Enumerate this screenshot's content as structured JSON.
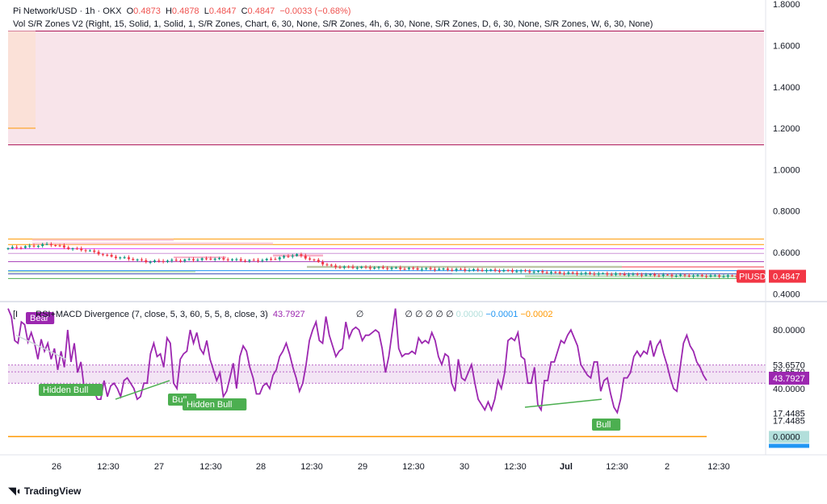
{
  "header": {
    "symbol": "Pi Network/USD · 1h · OKX",
    "open_label": "O",
    "open": "0.4873",
    "high_label": "H",
    "high": "0.4878",
    "low_label": "L",
    "low": "0.4847",
    "close_label": "C",
    "close": "0.4847",
    "change": "−0.0033 (−0.68%)",
    "indicator": "Vol S/R Zones V2 (Right, 15, Solid, 1, Solid, 1, S/R Zones, Chart, 6, 30, None, S/R Zones, 4h, 6, 30, None, S/R Zones, D, 6, 30, None, S/R Zones, W, 6, 30, None)"
  },
  "indicator_pane": {
    "prefix": "[I",
    "label": "RSI+MACD Divergence (7, close, 5, 3, 60, 5, 5, 8, close, 3)",
    "value": "43.7927",
    "empty": "∅",
    "empties": "∅ ∅ ∅ ∅ ∅",
    "v1": "0.0000",
    "v2": "−0.0001",
    "v3": "−0.0002"
  },
  "brand": {
    "name": "TradingView",
    "logo_icon": "tradingview-logo-icon"
  },
  "colors": {
    "price_tag": "#f23645",
    "rsi_line": "#9c27b0",
    "rsi_tag": "#9c27b0",
    "bull": "#4caf50",
    "bear": "#9c27b0",
    "macd_tag": "#b2dfdb",
    "macd_line": "#ff9800"
  },
  "chart_data": [
    {
      "type": "candlestick",
      "y_axis_ticks": [
        "1.8000",
        "1.6000",
        "1.4000",
        "1.2000",
        "1.0000",
        "0.8000",
        "0.6000",
        "0.4000"
      ],
      "ylim": [
        0.37,
        1.82
      ],
      "last_price_label": "PIUSD",
      "last_price": "0.4847",
      "close_path": [
        [
          0,
          0.62
        ],
        [
          5,
          0.63
        ],
        [
          9,
          0.64
        ],
        [
          13,
          0.62
        ],
        [
          17,
          0.61
        ],
        [
          22,
          0.58
        ],
        [
          26,
          0.57
        ],
        [
          30,
          0.555
        ],
        [
          35,
          0.56
        ],
        [
          40,
          0.565
        ],
        [
          44,
          0.57
        ],
        [
          48,
          0.565
        ],
        [
          52,
          0.56
        ],
        [
          56,
          0.565
        ],
        [
          60,
          0.58
        ],
        [
          62,
          0.59
        ],
        [
          66,
          0.56
        ],
        [
          70,
          0.53
        ],
        [
          80,
          0.525
        ],
        [
          90,
          0.52
        ],
        [
          100,
          0.515
        ],
        [
          110,
          0.51
        ],
        [
          120,
          0.5
        ],
        [
          130,
          0.495
        ],
        [
          140,
          0.49
        ],
        [
          150,
          0.487
        ],
        [
          157,
          0.485
        ]
      ],
      "x_tick_labels": [
        "26",
        "12:30",
        "27",
        "12:30",
        "28",
        "12:30",
        "29",
        "12:30",
        "30",
        "12:30",
        "Jul",
        "12:30",
        "2",
        "12:30"
      ],
      "zones": [
        {
          "from": 1.12,
          "to": 1.67,
          "color": "#f8e4ea"
        },
        {
          "from": 1.2,
          "to": 1.67,
          "color": "#fbe1d8"
        }
      ]
    },
    {
      "type": "line",
      "name": "RSI+MACD Divergence",
      "y_axis_ticks": [
        "80.0000",
        "53.6570",
        "53.6570",
        "40.0000",
        "17.4485",
        "17.4485",
        "0.0000"
      ],
      "levels": {
        "upper": 53.657,
        "mid": 48.5,
        "lower": 40.0
      },
      "last_value": "43.7927",
      "macd_value": "0.0000",
      "values": [
        96,
        90,
        72,
        70,
        86,
        84,
        71,
        78,
        70,
        58,
        73,
        64,
        70,
        58,
        66,
        50,
        64,
        52,
        80,
        56,
        70,
        48,
        56,
        36,
        35,
        34,
        34,
        28,
        28,
        42,
        30,
        38,
        40,
        36,
        30,
        42,
        44,
        40,
        36,
        28,
        30,
        40,
        40,
        62,
        70,
        60,
        62,
        52,
        74,
        70,
        40,
        36,
        58,
        62,
        64,
        80,
        70,
        78,
        66,
        62,
        72,
        58,
        50,
        42,
        48,
        30,
        34,
        44,
        55,
        36,
        60,
        68,
        64,
        52,
        44,
        32,
        32,
        38,
        40,
        36,
        46,
        50,
        60,
        64,
        70,
        62,
        52,
        44,
        34,
        40,
        54,
        72,
        80,
        86,
        72,
        70,
        90,
        76,
        68,
        60,
        64,
        66,
        86,
        74,
        80,
        82,
        80,
        72,
        76,
        76,
        78,
        80,
        78,
        66,
        48,
        60,
        78,
        96,
        66,
        60,
        62,
        62,
        64,
        62,
        74,
        70,
        72,
        70,
        78,
        72,
        60,
        54,
        62,
        60,
        40,
        34,
        58,
        44,
        42,
        48,
        54,
        40,
        28,
        24,
        20,
        26,
        20,
        28,
        42,
        36,
        48,
        72,
        74,
        72,
        78,
        60,
        58,
        40,
        40,
        52,
        24,
        20,
        42,
        42,
        56,
        56,
        64,
        72,
        70,
        76,
        80,
        74,
        68,
        54,
        50,
        46,
        44,
        56,
        56,
        34,
        42,
        44,
        32,
        22,
        18,
        28,
        44,
        44,
        48,
        60,
        64,
        60,
        64,
        62,
        72,
        60,
        68,
        72,
        62,
        54,
        44,
        36,
        34,
        52,
        70,
        76,
        68,
        64,
        56,
        52,
        46,
        42
      ]
    }
  ],
  "signals": [
    {
      "label": "Bear",
      "kind": "bear"
    },
    {
      "label": "Hidden Bull",
      "kind": "bull"
    },
    {
      "label": "Bull",
      "kind": "bull"
    },
    {
      "label": "Hidden Bull",
      "kind": "bull"
    },
    {
      "label": "Bull",
      "kind": "bull"
    }
  ]
}
